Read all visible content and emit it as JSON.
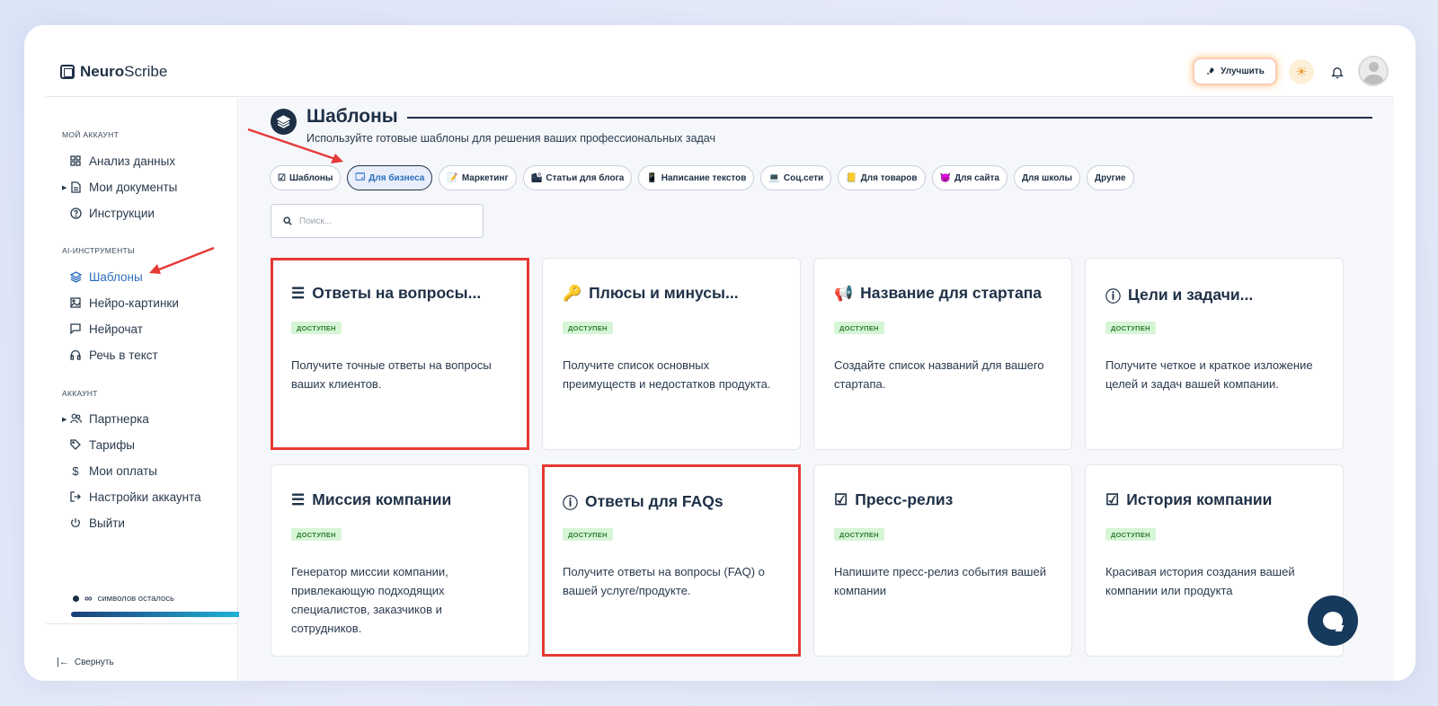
{
  "brand": {
    "bold": "Neuro",
    "light": "Scribe"
  },
  "header": {
    "upgrade_label": "Улучшить"
  },
  "sidebar": {
    "section_account": "МОЙ АККАУНТ",
    "account_items": [
      {
        "label": "Анализ данных",
        "icon": "grid-icon"
      },
      {
        "label": "Мои документы",
        "icon": "document-icon"
      },
      {
        "label": "Инструкции",
        "icon": "help-icon"
      }
    ],
    "section_ai": "AI-ИНСТРУМЕНТЫ",
    "ai_items": [
      {
        "label": "Шаблоны",
        "icon": "layers-icon"
      },
      {
        "label": "Нейро-картинки",
        "icon": "image-icon"
      },
      {
        "label": "Нейрочат",
        "icon": "chat-icon"
      },
      {
        "label": "Речь в текст",
        "icon": "headphones-icon"
      }
    ],
    "section_acc2": "АККАУНТ",
    "acc_items": [
      {
        "label": "Партнерка",
        "icon": "users-icon"
      },
      {
        "label": "Тарифы",
        "icon": "tag-icon"
      },
      {
        "label": "Мои оплаты",
        "icon": "dollar-icon"
      },
      {
        "label": "Настройки аккаунта",
        "icon": "login-icon"
      },
      {
        "label": "Выйти",
        "icon": "power-icon"
      }
    ],
    "credits_value": "∞",
    "credits_label": "символов осталось",
    "credits_fill": 1.0,
    "collapse_label": "Свернуть"
  },
  "main": {
    "title": "Шаблоны",
    "subtitle": "Используйте готовые шаблоны для решения ваших профессиональных задач",
    "categories": [
      {
        "label": "Шаблоны",
        "emoji": "☑"
      },
      {
        "label": "Для бизнеса",
        "emoji": "🗔"
      },
      {
        "label": "Маркетинг",
        "emoji": "📝"
      },
      {
        "label": "Статьи для блога",
        "emoji": "🏙"
      },
      {
        "label": "Написание текстов",
        "emoji": "📱"
      },
      {
        "label": "Соц.сети",
        "emoji": "💻"
      },
      {
        "label": "Для товаров",
        "emoji": "📒"
      },
      {
        "label": "Для сайта",
        "emoji": "😈"
      },
      {
        "label": "Для школы",
        "emoji": ""
      },
      {
        "label": "Другие",
        "emoji": ""
      }
    ],
    "active_category": 1,
    "search_placeholder": "Поиск...",
    "cards": [
      {
        "title": "Ответы на вопросы...",
        "badge": "ДОСТУПЕН",
        "desc": "Получите точные ответы на вопросы ваших клиентов.",
        "icon": "list-icon",
        "glyph": "☰"
      },
      {
        "title": "Плюсы и минусы...",
        "badge": "ДОСТУПЕН",
        "desc": "Получите список основных преимуществ и недостатков продукта.",
        "icon": "key-icon",
        "glyph": "🔑"
      },
      {
        "title": "Название для стартапа",
        "badge": "ДОСТУПЕН",
        "desc": "Создайте список названий для вашего стартапа.",
        "icon": "megaphone-icon",
        "glyph": "📢"
      },
      {
        "title": "Цели и задачи...",
        "badge": "ДОСТУПЕН",
        "desc": "Получите четкое и краткое изложение целей и задач вашей компании.",
        "icon": "alert-icon",
        "glyph": "ⓘ"
      },
      {
        "title": "Миссия компании",
        "badge": "ДОСТУПЕН",
        "desc": "Генератор миссии компании, привлекающую подходящих специалистов, заказчиков и сотрудников.",
        "icon": "text-lines-icon",
        "glyph": "☰"
      },
      {
        "title": "Ответы для FAQs",
        "badge": "ДОСТУПЕН",
        "desc": "Получите ответы на вопросы (FAQ) о вашей услуге/продукте.",
        "icon": "alert-icon",
        "glyph": "ⓘ"
      },
      {
        "title": "Пресс-релиз",
        "badge": "ДОСТУПЕН",
        "desc": "Напишите пресс-релиз события вашей компании",
        "icon": "checkbox-icon",
        "glyph": "☑"
      },
      {
        "title": "История компании",
        "badge": "ДОСТУПЕН",
        "desc": "Красивая история создания вашей компании или продукта",
        "icon": "checkbox-icon",
        "glyph": "☑"
      }
    ]
  },
  "colors": {
    "accent": "#2c6fbd",
    "navy": "#1e3046",
    "highlight": "#e53935",
    "badge_bg": "#d6f5d6",
    "badge_text": "#2f7d32"
  }
}
